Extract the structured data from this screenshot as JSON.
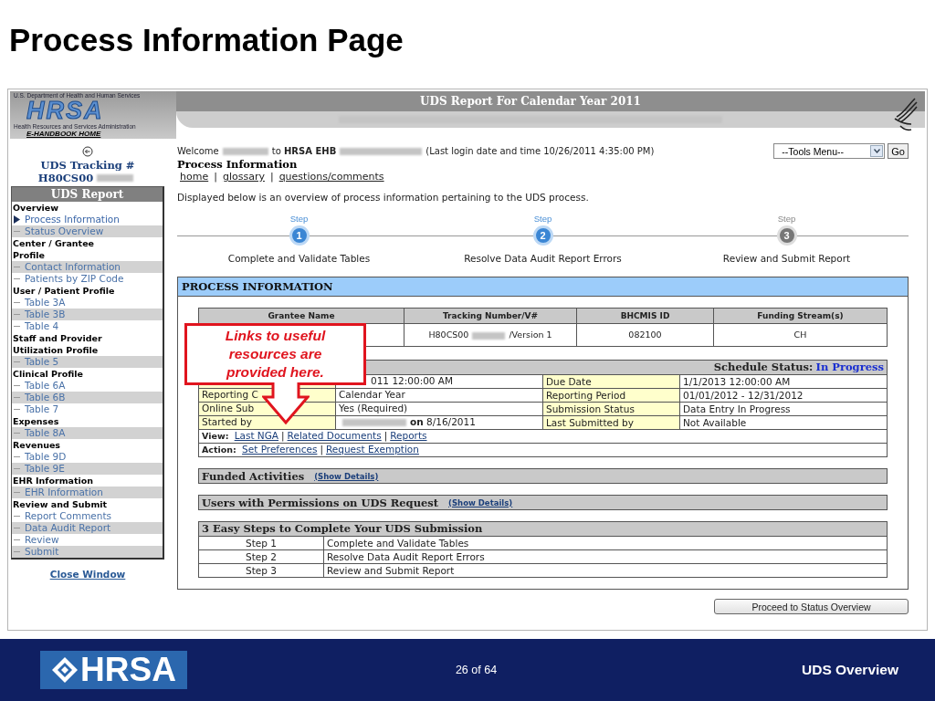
{
  "slide_title": "Process Information Page",
  "header": {
    "agency": "U.S. Department of Health and Human Services",
    "logo": "HRSA",
    "subtitle": "Health Resources and Services Administration",
    "home_link": "E-HANDBOOK HOME",
    "title": "UDS Report For Calendar Year 2011"
  },
  "sidebar": {
    "tracking_label": "UDS Tracking #",
    "tracking_number": "H80CS00",
    "nav_title": "UDS Report",
    "close_link": "Close Window",
    "sections": [
      {
        "title": "Overview",
        "items": [
          {
            "label": "Process Information",
            "selected": true,
            "shaded": false
          },
          {
            "label": "Status Overview",
            "selected": false,
            "shaded": true
          }
        ]
      },
      {
        "title": "Center / Grantee Profile",
        "items": [
          {
            "label": "Contact Information",
            "selected": false,
            "shaded": true
          },
          {
            "label": "Patients by ZIP Code",
            "selected": false,
            "shaded": false
          }
        ]
      },
      {
        "title": "User / Patient Profile",
        "items": [
          {
            "label": "Table 3A",
            "selected": false,
            "shaded": false
          },
          {
            "label": "Table 3B",
            "selected": false,
            "shaded": true
          },
          {
            "label": "Table 4",
            "selected": false,
            "shaded": false
          }
        ]
      },
      {
        "title": "Staff and Provider Utilization Profile",
        "items": [
          {
            "label": "Table 5",
            "selected": false,
            "shaded": true
          }
        ]
      },
      {
        "title": "Clinical Profile",
        "items": [
          {
            "label": "Table 6A",
            "selected": false,
            "shaded": false
          },
          {
            "label": "Table 6B",
            "selected": false,
            "shaded": true
          },
          {
            "label": "Table 7",
            "selected": false,
            "shaded": false
          }
        ]
      },
      {
        "title": "Expenses",
        "items": [
          {
            "label": "Table 8A",
            "selected": false,
            "shaded": true
          }
        ]
      },
      {
        "title": "Revenues",
        "items": [
          {
            "label": "Table 9D",
            "selected": false,
            "shaded": false
          },
          {
            "label": "Table 9E",
            "selected": false,
            "shaded": true
          }
        ]
      },
      {
        "title": "EHR Information",
        "items": [
          {
            "label": "EHR Information",
            "selected": false,
            "shaded": true
          }
        ]
      },
      {
        "title": "Review and Submit",
        "items": [
          {
            "label": "Report Comments",
            "selected": false,
            "shaded": false
          },
          {
            "label": "Data Audit Report",
            "selected": false,
            "shaded": true
          },
          {
            "label": "Review",
            "selected": false,
            "shaded": false
          },
          {
            "label": "Submit",
            "selected": false,
            "shaded": true
          }
        ]
      }
    ]
  },
  "welcome": {
    "greeting": "Welcome",
    "site": "to **HRSA EHB**",
    "last_login": "(Last login date and time 10/26/2011 4:35:00 PM)"
  },
  "tools": {
    "menu": "--Tools Menu--",
    "go": "Go"
  },
  "page_heading": "Process Information",
  "links": [
    "home",
    "glossary",
    "questions/comments"
  ],
  "separator": "|",
  "intro": "Displayed below is an overview of process information pertaining to the UDS process.",
  "steps": [
    {
      "caption": "Step",
      "number": "1",
      "label": "Complete and Validate Tables",
      "active": true
    },
    {
      "caption": "Step",
      "number": "2",
      "label": "Resolve Data Audit Report Errors",
      "active": true
    },
    {
      "caption": "Step",
      "number": "3",
      "label": "Review and Submit Report",
      "active": false
    }
  ],
  "panel": {
    "title": "PROCESS INFORMATION",
    "grantee_columns": [
      "Grantee Name",
      "Tracking Number/V#",
      "BHCMIS ID",
      "Funding Stream(s)"
    ],
    "grantee_row": {
      "tracking_number": "H80CS00",
      "version": "/Version 1",
      "bhcmis_id": "082100",
      "funding": "CH"
    },
    "schedule": {
      "label": "Schedule Status:",
      "value": "In Progress"
    },
    "details": [
      {
        "value": "011 12:00:00 AM",
        "label_2": "Due Date",
        "value_2": "1/1/2013 12:00:00 AM"
      },
      {
        "label": "Reporting C",
        "value": "Calendar Year",
        "label_2": "Reporting Period",
        "value_2": "01/01/2012 - 12/31/2012"
      },
      {
        "label": "Online Sub",
        "value": "Yes (Required)",
        "label_2": "Submission Status",
        "value_2": "Data Entry In Progress"
      },
      {
        "label": "Started by",
        "value": "**on** 8/16/2011",
        "redacted": true,
        "label_2": "Last Submitted by",
        "value_2": "Not Available"
      }
    ],
    "view": {
      "label": "View:",
      "links": [
        "Last NGA",
        "Related Documents",
        "Reports"
      ]
    },
    "action": {
      "label": "Action:",
      "links": [
        "Set Preferences",
        "Request Exemption"
      ]
    },
    "sections": [
      {
        "title": "Funded Activities",
        "link": "(Show Details)"
      },
      {
        "title": "Users with Permissions on UDS Request",
        "link": "(Show Details)"
      }
    ],
    "easy_steps": {
      "title": "3 Easy Steps to Complete Your UDS Submission",
      "rows": [
        {
          "step": "Step 1",
          "task": "Complete and Validate Tables"
        },
        {
          "step": "Step 2",
          "task": "Resolve Data Audit Report Errors"
        },
        {
          "step": "Step 3",
          "task": "Review and Submit Report"
        }
      ]
    },
    "callout": "Links to useful resources are provided here."
  },
  "proceed_button": "Proceed to Status Overview",
  "footer": {
    "logo": "HRSA",
    "page": "26 of 64",
    "title": "UDS Overview"
  }
}
